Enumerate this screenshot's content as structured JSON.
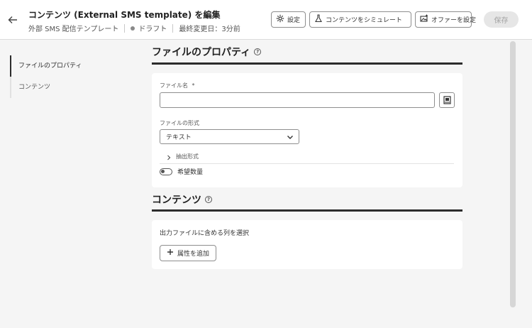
{
  "header": {
    "title": "コンテンツ (External SMS template) を編集",
    "subtitle": {
      "template_name": "外部 SMS 配信テンプレート",
      "status": "ドラフト",
      "modified": "最終変更日：3分前"
    },
    "buttons": {
      "settings": "設定",
      "simulate": "コンテンツをシミュレート",
      "offers": "オファーを設定",
      "save": "保存"
    }
  },
  "sidebar": {
    "items": [
      {
        "label": "ファイルのプロパティ",
        "active": true
      },
      {
        "label": "コンテンツ",
        "active": false
      }
    ]
  },
  "file_properties": {
    "section_title": "ファイルのプロパティ",
    "file_name_label": "ファイル名",
    "required_mark": "*",
    "file_name_value": "",
    "file_format_label": "ファイルの形式",
    "file_format_value": "テキスト",
    "extract_format_label": "抽出形式",
    "desired_quantity_label": "希望数量"
  },
  "content": {
    "section_title": "コンテンツ",
    "description": "出力ファイルに含める列を選択",
    "add_attribute": "属性を追加"
  }
}
